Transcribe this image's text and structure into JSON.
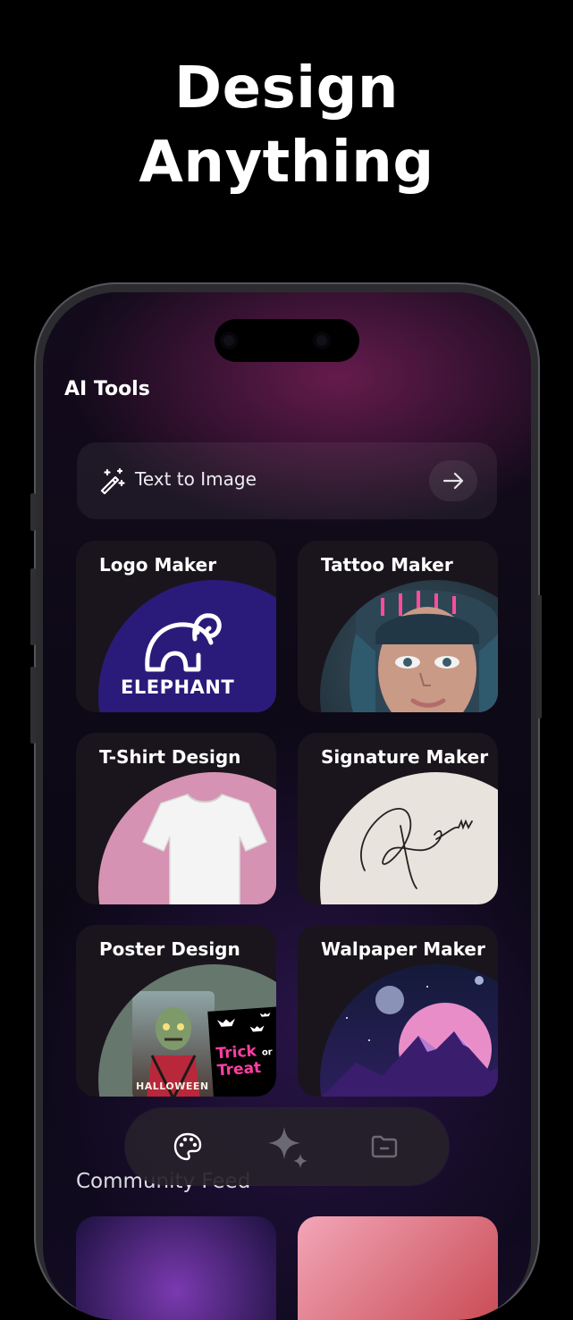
{
  "headline": {
    "line1": "Design",
    "line2": "Anything"
  },
  "section_title": "AI Tools",
  "text_to_image": {
    "label": "Text to Image"
  },
  "tools": [
    {
      "title": "Logo Maker",
      "art_text": "ELEPHANT"
    },
    {
      "title": "Tattoo Maker"
    },
    {
      "title": "T-Shirt Design"
    },
    {
      "title": "Signature Maker"
    },
    {
      "title": "Poster Design",
      "art_text_left": "HALLOWEEN",
      "art_text_right_1": "Trick",
      "art_text_right_2": "or",
      "art_text_right_3": "Treat"
    },
    {
      "title": "Walpaper Maker"
    }
  ],
  "community_feed": "Community Feed",
  "nav": {
    "items": [
      "palette-icon",
      "sparkle-icon",
      "folder-icon"
    ]
  },
  "colors": {
    "logo_bg": "#2a1b7a",
    "tshirt_bg": "#d692b2",
    "signature_bg": "#e8e3dc",
    "poster_bg": "#66776d"
  }
}
